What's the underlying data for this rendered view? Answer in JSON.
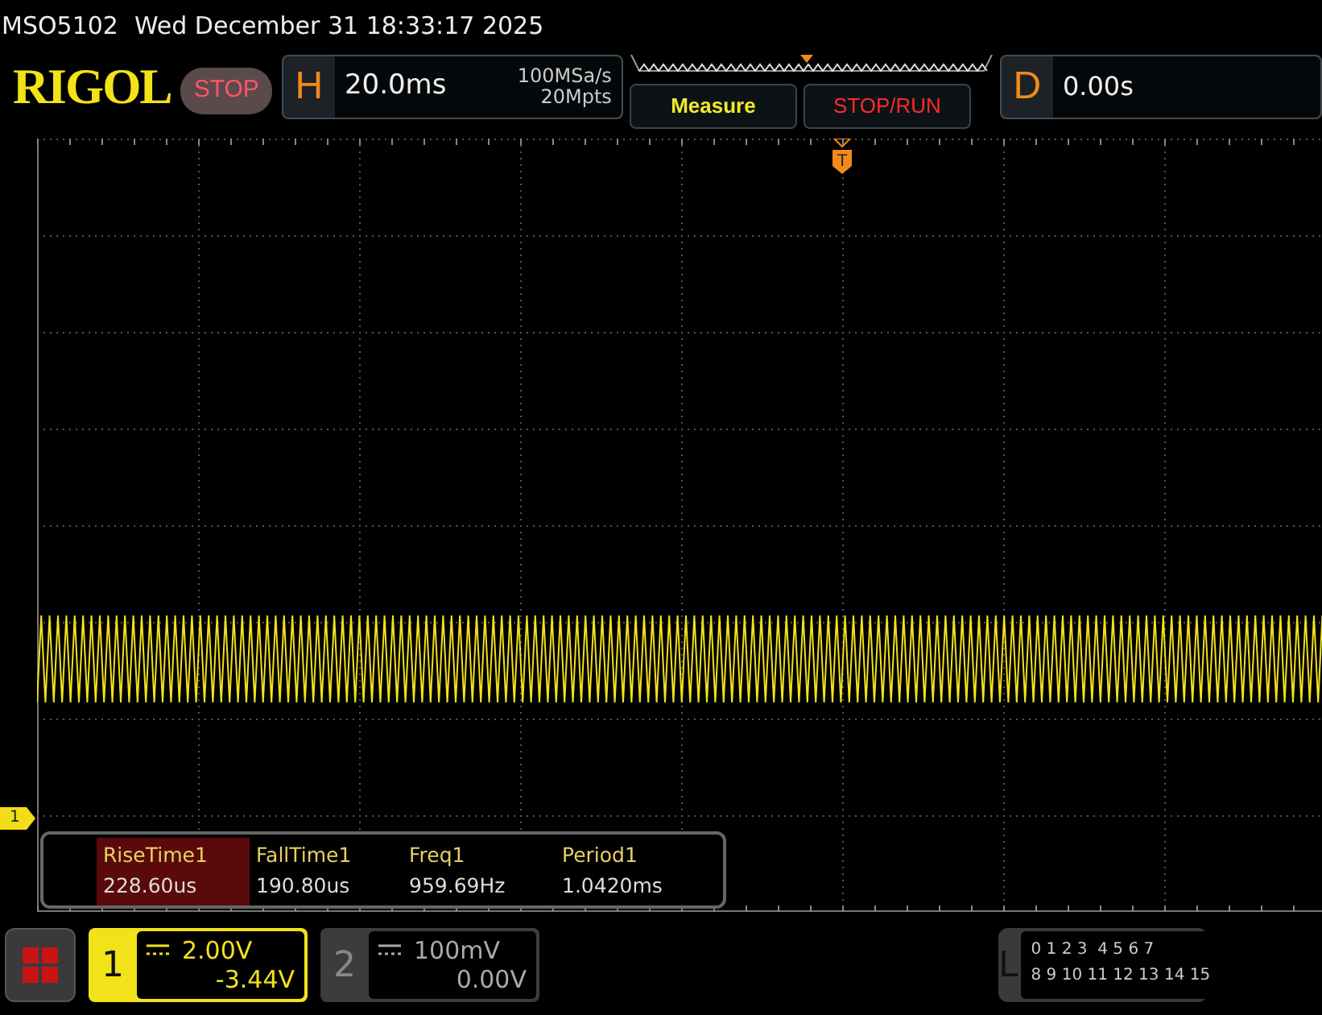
{
  "title_bar": {
    "model": "MSO5102",
    "datetime": "Wed December 31 18:33:17 2025"
  },
  "header": {
    "logo": "RIGOL",
    "run_state": "STOP",
    "horizontal": {
      "label": "H",
      "timebase": "20.0ms",
      "sample_rate": "100MSa/s",
      "memory_depth": "20Mpts"
    },
    "buttons": [
      {
        "label": "Measure",
        "kind": "measure"
      },
      {
        "label": "STOP/RUN",
        "kind": "stop_run"
      }
    ],
    "delay": {
      "label": "D",
      "value": "0.00s"
    }
  },
  "trigger_marker": "T",
  "channel_marker": "1",
  "measurements": [
    {
      "name": "RiseTime1",
      "value": "228.60us",
      "selected": true
    },
    {
      "name": "FallTime1",
      "value": "190.80us",
      "selected": false
    },
    {
      "name": "Freq1",
      "value": "959.69Hz",
      "selected": false
    },
    {
      "name": "Period1",
      "value": "1.0420ms",
      "selected": false
    }
  ],
  "channels": [
    {
      "number": "1",
      "scale": "2.00V",
      "offset": "-3.44V",
      "active": true
    },
    {
      "number": "2",
      "scale": "100mV",
      "offset": "0.00V",
      "active": false
    }
  ],
  "logic": {
    "label": "L",
    "rows": [
      "0 1 2 3  4 5 6 7",
      "8 9 10 11 12 13 14 15"
    ]
  }
}
